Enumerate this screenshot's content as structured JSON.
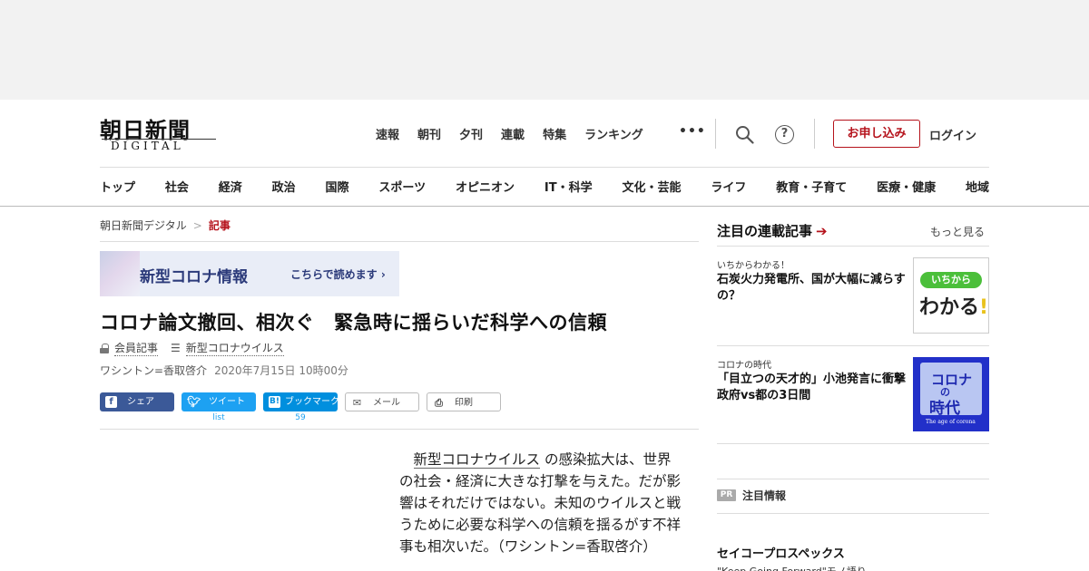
{
  "header": {
    "logo_kanji": "朝日新聞",
    "logo_latin": "DIGITAL",
    "top_nav": [
      "速報",
      "朝刊",
      "夕刊",
      "連載",
      "特集",
      "ランキング"
    ],
    "more_label": "•••",
    "subscribe_label": "お申し込み",
    "login_label": "ログイン"
  },
  "category_nav": [
    "トップ",
    "社会",
    "経済",
    "政治",
    "国際",
    "スポーツ",
    "オピニオン",
    "IT・科学",
    "文化・芸能",
    "ライフ",
    "教育・子育て",
    "医療・健康",
    "地域"
  ],
  "breadcrumb": {
    "home": "朝日新聞デジタル",
    "separator": ">",
    "current": "記事"
  },
  "banner": {
    "title": "新型コロナ情報",
    "cta": "こちらで読めます ›"
  },
  "article": {
    "title": "コロナ論文撤回、相次ぐ　緊急時に揺らいだ科学への信頼",
    "member_label": "会員記事",
    "topic_label": "新型コロナウイルス",
    "byline": "ワシントン=香取啓介",
    "date": "2020年7月15日 10時00分",
    "body_keyword": "新型コロナウイルス",
    "body_rest": "の感染拡大は、世界の社会・経済に大きな打撃を与えた。だが影響はそれだけではない。未知のウイルスと戦うために必要な科学への信頼を揺るがす不祥事も相次いだ。（ワシントン=香取啓介）"
  },
  "share": {
    "facebook": "シェア",
    "twitter": "ツイート",
    "twitter_count": "list",
    "hatena": "ブックマーク",
    "hatena_count": "59",
    "mail": "メール",
    "print": "印刷"
  },
  "sidebar": {
    "heading": "注目の連載記事",
    "more": "もっと見る",
    "items": [
      {
        "kicker": "いちからわかる！",
        "headline": "石炭火力発電所、国が大幅に減らすの？",
        "thumb_pill": "いちから",
        "thumb_big": "わかる",
        "thumb_mark": "!"
      },
      {
        "kicker": "コロナの時代",
        "headline": "「目立つの天才的」小池発言に衝撃　政府vs都の3日間",
        "thumb_k1": "コロナ",
        "thumb_k2": "の",
        "thumb_k3": "時代",
        "thumb_caption": "The age of corona"
      }
    ],
    "pr_badge": "PR",
    "pr_label": "注目情報",
    "sponsor": "セイコープロスペックス",
    "sponsor_sub": "\"Keep Going Forward\"モノ語り"
  },
  "colors": {
    "accent": "#b5121b",
    "facebook": "#3b5998",
    "twitter": "#1da1f2",
    "hatena": "#008fde"
  }
}
